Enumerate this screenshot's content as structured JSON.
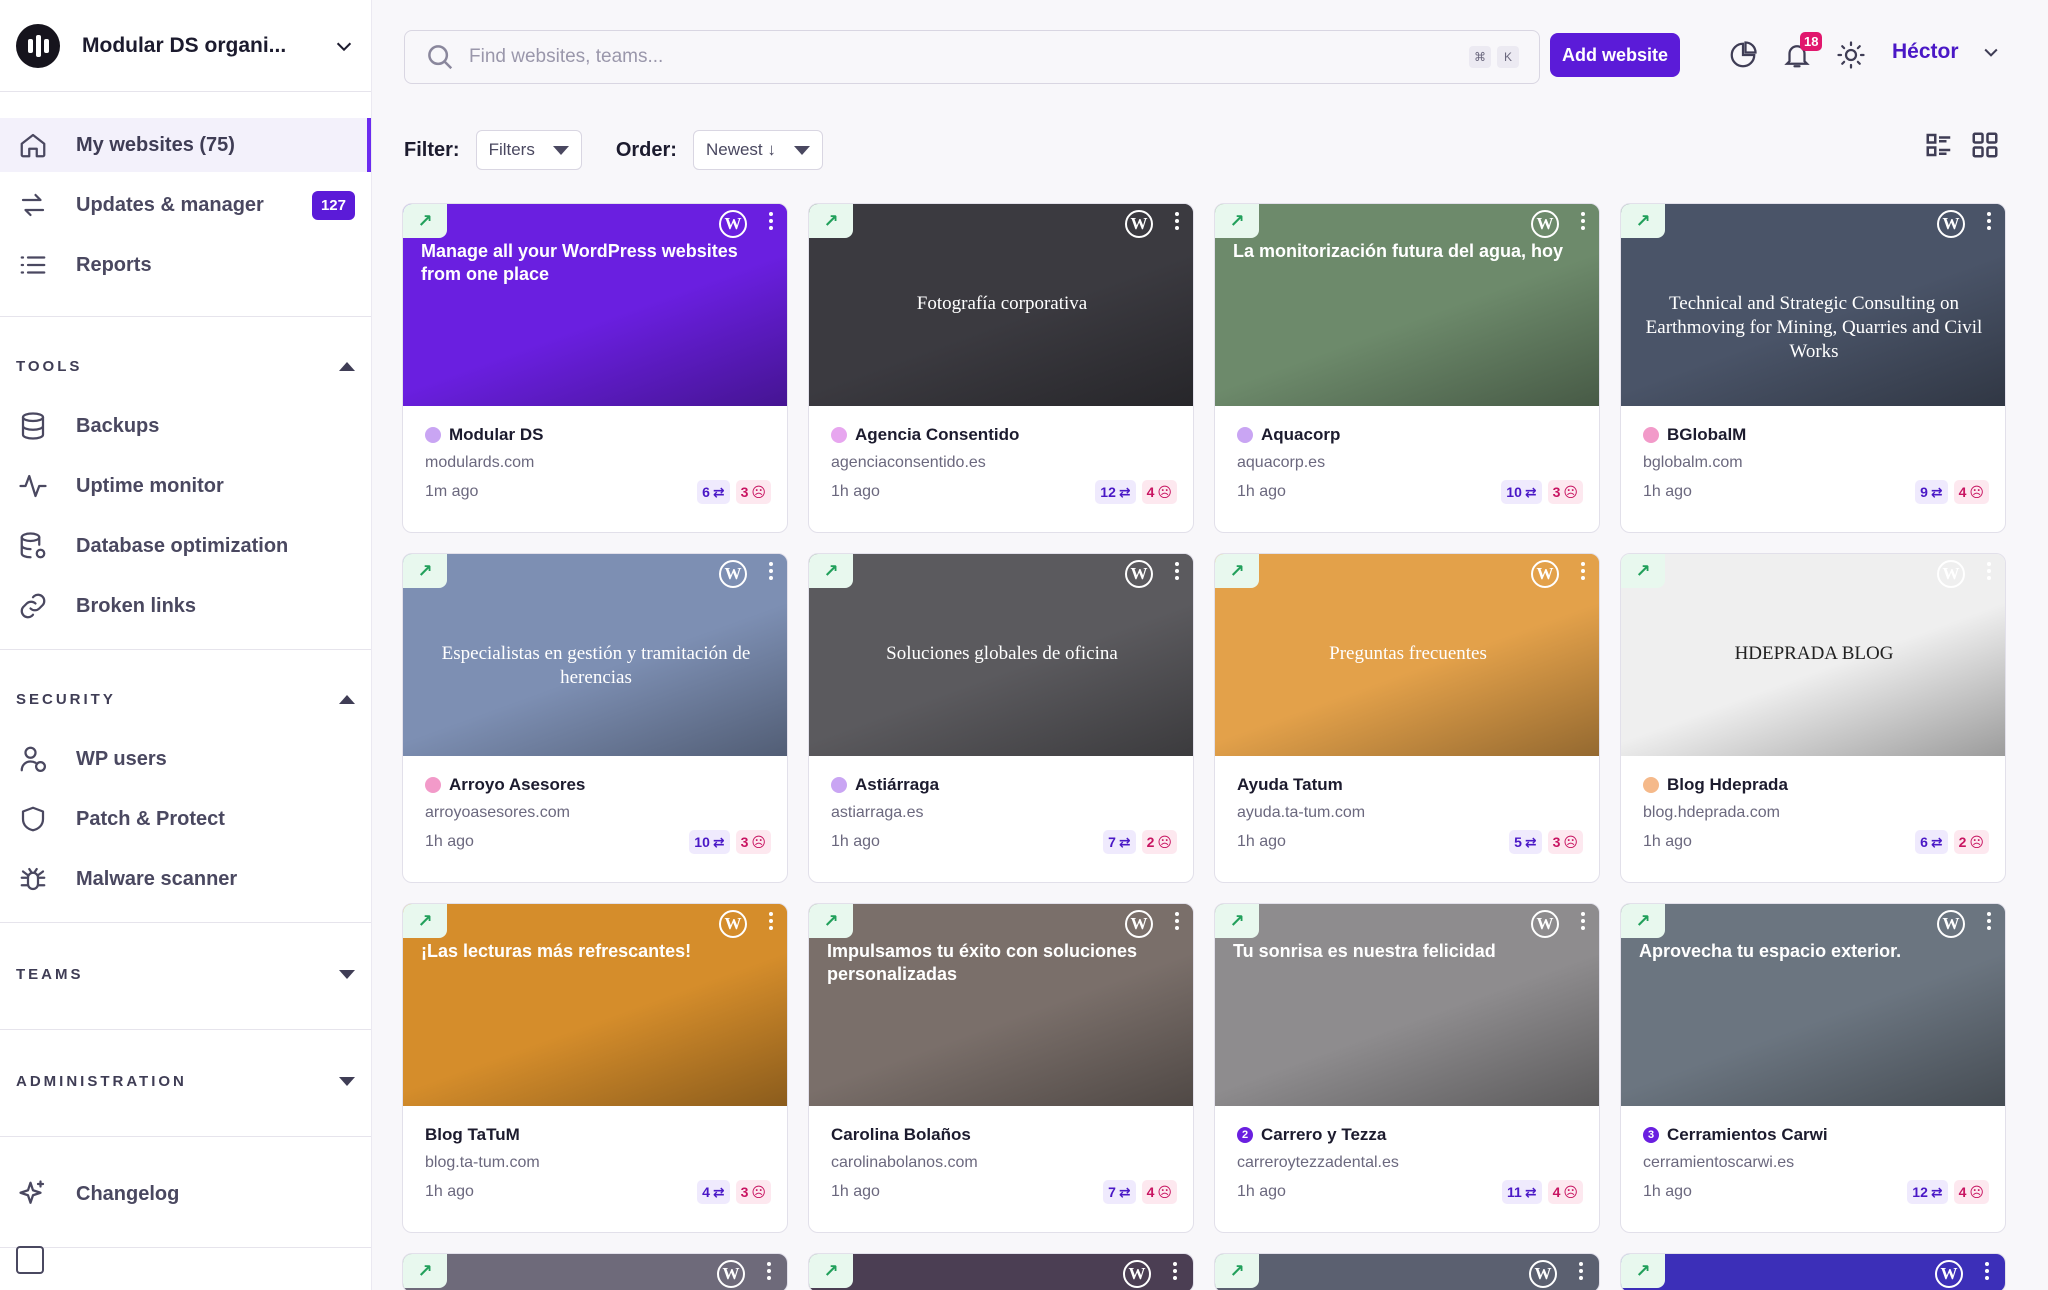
{
  "org": {
    "name": "Modular DS organi..."
  },
  "nav": [
    {
      "label": "My websites (75)",
      "icon": "home-icon",
      "active": true
    },
    {
      "label": "Updates & manager",
      "icon": "sync-icon",
      "badge": "127"
    },
    {
      "label": "Reports",
      "icon": "list-icon"
    }
  ],
  "tools": {
    "title": "TOOLS",
    "items": [
      {
        "label": "Backups",
        "icon": "database-icon"
      },
      {
        "label": "Uptime monitor",
        "icon": "pulse-icon"
      },
      {
        "label": "Database optimization",
        "icon": "database-gear-icon"
      },
      {
        "label": "Broken links",
        "icon": "link-icon"
      }
    ]
  },
  "security": {
    "title": "SECURITY",
    "items": [
      {
        "label": "WP users",
        "icon": "user-wp-icon"
      },
      {
        "label": "Patch & Protect",
        "icon": "shield-icon"
      },
      {
        "label": "Malware scanner",
        "icon": "bug-icon"
      }
    ]
  },
  "teams": {
    "title": "TEAMS"
  },
  "administration": {
    "title": "ADMINISTRATION"
  },
  "changelog": {
    "label": "Changelog",
    "icon": "sparkle-icon"
  },
  "topbar": {
    "search_placeholder": "Find websites, teams...",
    "kbd1": "⌘",
    "kbd2": "K",
    "add_label": "Add website",
    "notif_count": "18",
    "user": "Héctor"
  },
  "filterbar": {
    "filter_label": "Filter:",
    "filter_value": "Filters",
    "order_label": "Order:",
    "order_value": "Newest ↓"
  },
  "cards": [
    {
      "name": "Modular DS",
      "url": "modulards.com",
      "time": "1m ago",
      "updates": "6",
      "vulns": "3",
      "dot": "#c9a5f3",
      "bg": "#6a1fe0",
      "caption": "Manage all your WordPress websites from one place",
      "style": "sans"
    },
    {
      "name": "Agencia Consentido",
      "url": "agenciaconsentido.es",
      "time": "1h ago",
      "updates": "12",
      "vulns": "4",
      "dot": "#e7a6ef",
      "bg": "#3b3a40",
      "caption": "Fotografía corporativa",
      "style": "serif"
    },
    {
      "name": "Aquacorp",
      "url": "aquacorp.es",
      "time": "1h ago",
      "updates": "10",
      "vulns": "3",
      "dot": "#c9a5f3",
      "bg": "#6d8a6b",
      "caption": "La monitorización futura del agua, hoy",
      "style": "sans"
    },
    {
      "name": "BGlobalM",
      "url": "bglobalm.com",
      "time": "1h ago",
      "updates": "9",
      "vulns": "4",
      "dot": "#f29ac9",
      "bg": "#4a5468",
      "caption": "Technical and Strategic Consulting on Earthmoving for Mining, Quarries and Civil Works",
      "style": "serif"
    },
    {
      "name": "Arroyo Asesores",
      "url": "arroyoasesores.com",
      "time": "1h ago",
      "updates": "10",
      "vulns": "3",
      "dot": "#f29ac9",
      "bg": "#7d8fb3",
      "caption": "Especialistas en gestión y tramitación de herencias",
      "style": "serif"
    },
    {
      "name": "Astiárraga",
      "url": "astiarraga.es",
      "time": "1h ago",
      "updates": "7",
      "vulns": "2",
      "dot": "#c9a5f3",
      "bg": "#5b5a5e",
      "caption": "Soluciones globales de oficina",
      "style": "serif"
    },
    {
      "name": "Ayuda Tatum",
      "url": "ayuda.ta-tum.com",
      "time": "1h ago",
      "updates": "5",
      "vulns": "3",
      "dot": "",
      "bg": "#e3a14a",
      "caption": "Preguntas frecuentes",
      "style": "serif"
    },
    {
      "name": "Blog Hdeprada",
      "url": "blog.hdeprada.com",
      "time": "1h ago",
      "updates": "6",
      "vulns": "2",
      "dot": "#f5b98a",
      "bg": "#efefef",
      "caption": "HDEPRADA BLOG",
      "style": "serif"
    },
    {
      "name": "Blog TaTuM",
      "url": "blog.ta-tum.com",
      "time": "1h ago",
      "updates": "4",
      "vulns": "3",
      "dot": "",
      "bg": "#d58d2b",
      "caption": "¡Las lecturas más refrescantes!",
      "style": "sans"
    },
    {
      "name": "Carolina Bolaños",
      "url": "carolinabolanos.com",
      "time": "1h ago",
      "updates": "7",
      "vulns": "4",
      "dot": "",
      "bg": "#7a6f6a",
      "caption": "Impulsamos tu éxito con soluciones personalizadas",
      "style": "sans"
    },
    {
      "name": "Carrero y Tezza",
      "url": "carreroytezzadental.es",
      "time": "1h ago",
      "updates": "11",
      "vulns": "4",
      "dot": "#6a1fe0",
      "dotnum": "2",
      "bg": "#8e8c8e",
      "caption": "Tu sonrisa es nuestra felicidad",
      "style": "sans"
    },
    {
      "name": "Cerramientos Carwi",
      "url": "cerramientoscarwi.es",
      "time": "1h ago",
      "updates": "12",
      "vulns": "4",
      "dot": "#6a1fe0",
      "dotnum": "3",
      "bg": "#6b7580",
      "caption": "Aprovecha tu espacio exterior.",
      "style": "sans"
    }
  ],
  "colors": {
    "accent": "#5b1bd8",
    "update": "#4a18c6",
    "vuln": "#c81461",
    "ok": "#22a05b"
  }
}
